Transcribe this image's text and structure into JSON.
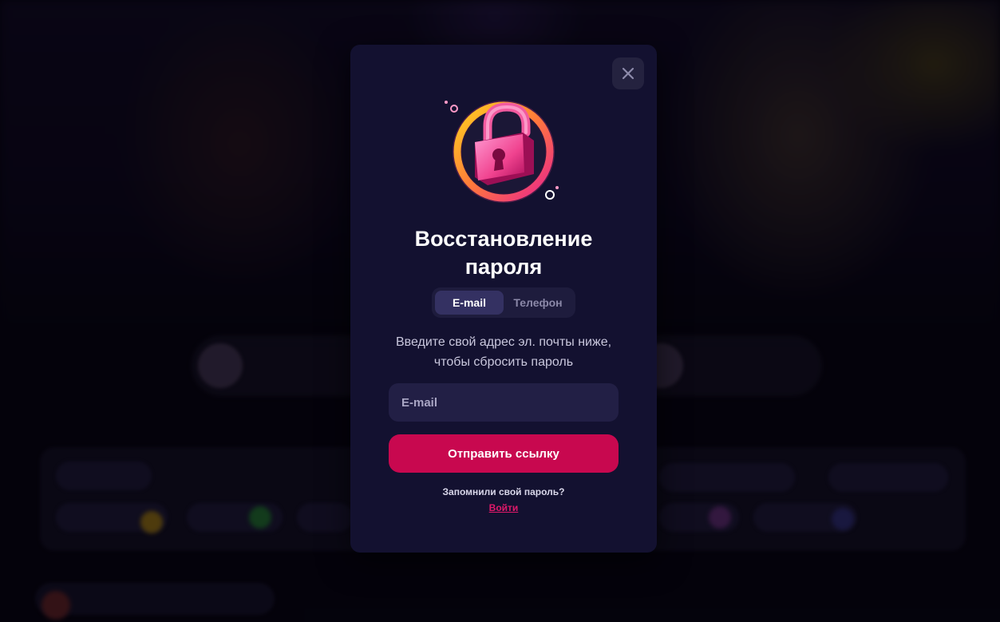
{
  "modal": {
    "title_line1": "Восстановление",
    "title_line2": "пароля",
    "close_icon": "close-icon",
    "illustration": "padlock-icon",
    "tabs": [
      {
        "label": "E-mail",
        "active": true
      },
      {
        "label": "Телефон",
        "active": false
      }
    ],
    "instructions_line1": "Введите свой адрес эл. почты ниже,",
    "instructions_line2": "чтобы сбросить пароль",
    "email_placeholder": "E-mail",
    "email_value": "",
    "submit_label": "Отправить ссылку",
    "remember_text": "Запомнили свой пароль?",
    "login_label": "Войти"
  },
  "colors": {
    "modal_bg": "#131130",
    "accent": "#c8084f",
    "link": "#e0196a",
    "tab_active": "#343162",
    "input_bg": "#221f45"
  }
}
